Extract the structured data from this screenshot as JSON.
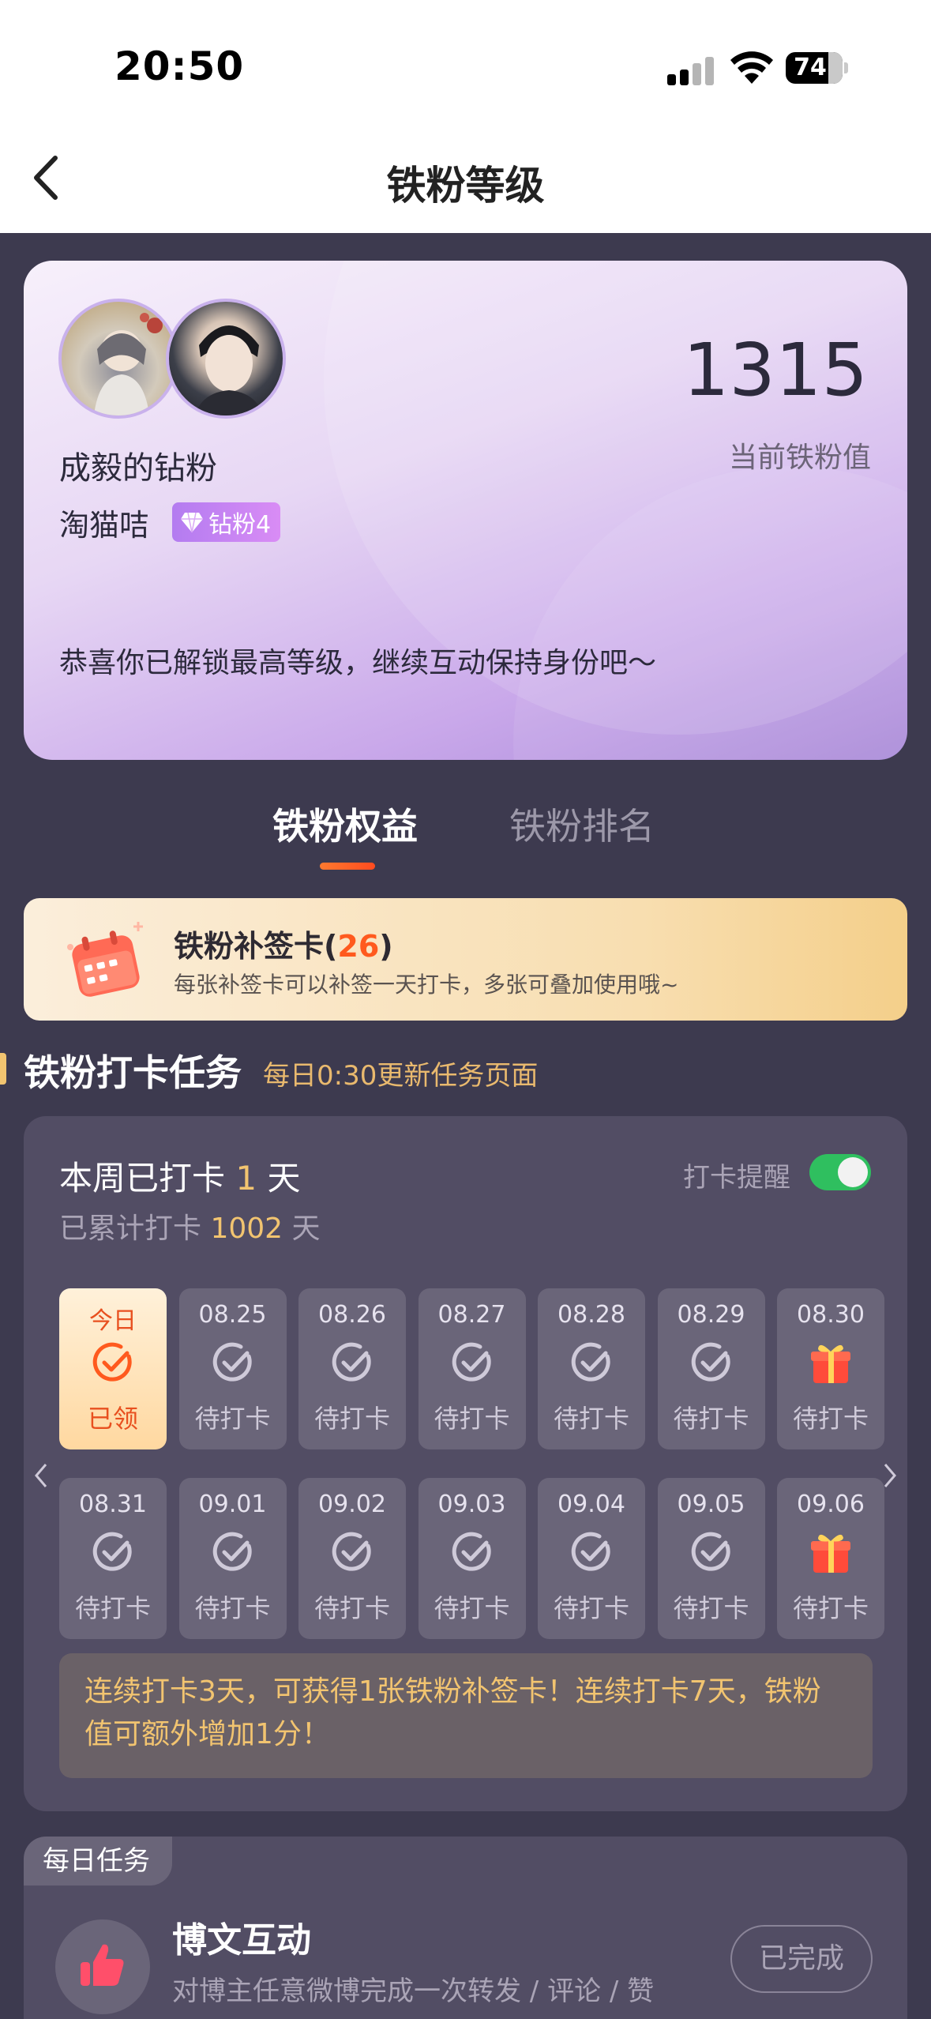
{
  "status_bar": {
    "time": "20:50",
    "battery": "74"
  },
  "nav": {
    "title": "铁粉等级"
  },
  "hero": {
    "score": "1315",
    "score_label": "当前铁粉值",
    "title": "成毅的钻粉",
    "username": "淘猫咭",
    "badge": "钻粉4",
    "message": "恭喜你已解锁最高等级，继续互动保持身份吧～"
  },
  "tabs": [
    {
      "label": "铁粉权益",
      "active": true
    },
    {
      "label": "铁粉排名",
      "active": false
    }
  ],
  "bonus_card": {
    "title": "铁粉补签卡",
    "count_open": "(",
    "count": "26",
    "count_close": ")",
    "subtitle": "每张补签卡可以补签一天打卡，多张可叠加使用哦~"
  },
  "checkin_section": {
    "title": "铁粉打卡任务",
    "subtitle": "每日0:30更新任务页面"
  },
  "checkin": {
    "week_prefix": "本周已打卡",
    "week_count": "1",
    "week_suffix": "天",
    "total_prefix": "已累计打卡",
    "total_count": "1002",
    "total_suffix": "天",
    "remind_label": "打卡提醒",
    "remind_on": true,
    "days": [
      {
        "date": "今日",
        "status": "已领",
        "icon": "check-icon",
        "today": true
      },
      {
        "date": "08.25",
        "status": "待打卡",
        "icon": "check-icon"
      },
      {
        "date": "08.26",
        "status": "待打卡",
        "icon": "check-icon"
      },
      {
        "date": "08.27",
        "status": "待打卡",
        "icon": "check-icon"
      },
      {
        "date": "08.28",
        "status": "待打卡",
        "icon": "check-icon"
      },
      {
        "date": "08.29",
        "status": "待打卡",
        "icon": "check-icon"
      },
      {
        "date": "08.30",
        "status": "待打卡",
        "icon": "gift-icon"
      },
      {
        "date": "08.31",
        "status": "待打卡",
        "icon": "check-icon"
      },
      {
        "date": "09.01",
        "status": "待打卡",
        "icon": "check-icon"
      },
      {
        "date": "09.02",
        "status": "待打卡",
        "icon": "check-icon"
      },
      {
        "date": "09.03",
        "status": "待打卡",
        "icon": "check-icon"
      },
      {
        "date": "09.04",
        "status": "待打卡",
        "icon": "check-icon"
      },
      {
        "date": "09.05",
        "status": "待打卡",
        "icon": "check-icon"
      },
      {
        "date": "09.06",
        "status": "待打卡",
        "icon": "gift-icon"
      }
    ],
    "tip": "连续打卡3天，可获得1张铁粉补签卡！连续打卡7天，铁粉值可额外增加1分！"
  },
  "daily_task": {
    "tag": "每日任务",
    "title": "博文互动",
    "description": "对博主任意微博完成一次转发 / 评论 / 赞",
    "button": "已完成"
  },
  "colors": {
    "page_bg": "#3d3a4f",
    "card_bg": "#524d64",
    "accent_gold": "#f2c470",
    "accent_orange": "#ff5a1e",
    "toggle_on": "#2fbf5f"
  }
}
